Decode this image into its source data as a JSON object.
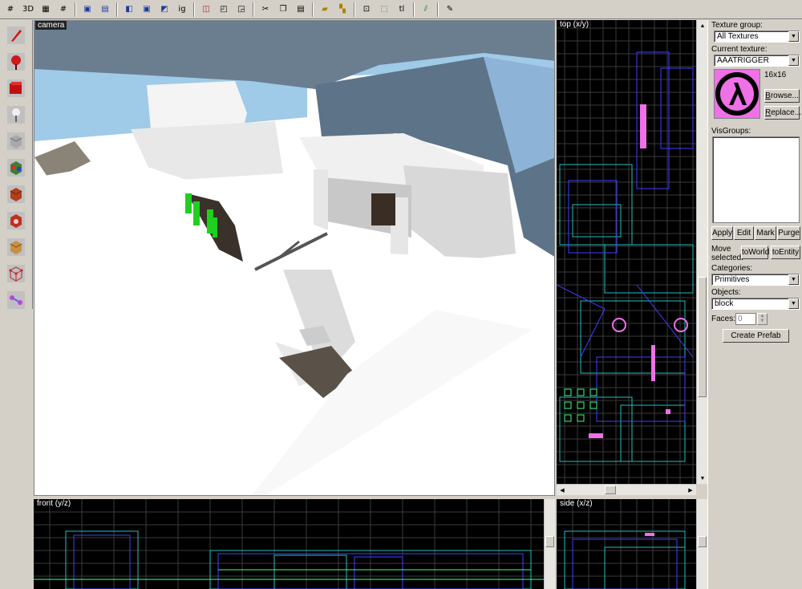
{
  "toolbar": {
    "buttons": [
      "grid-icon",
      "3d-grid-icon",
      "grid-small-icon",
      "grid-large-icon",
      "group-icon",
      "ungroup-icon",
      "hide-icon",
      "carve-icon",
      "ig",
      "hollow-icon",
      "cube-icon",
      "cube-outline-icon",
      "cut-icon",
      "copy-icon",
      "paste-icon",
      "texture-lock-icon",
      "texture-lock2-icon",
      "select-icon",
      "select-region-icon",
      "tl",
      "check-icon",
      "options-icon"
    ],
    "ig_label": "ig",
    "tl_label": "tl"
  },
  "tools": [
    "pointer-tool-icon",
    "magnify-tool-icon",
    "camera-tool-icon",
    "entity-tool-icon",
    "block-tool-icon",
    "texture-tool-icon",
    "apply-texture-icon",
    "decal-tool-icon",
    "clip-tool-icon",
    "vertex-tool-icon",
    "path-tool-icon"
  ],
  "viewports": {
    "camera": "camera",
    "top": "top (x/y)",
    "front": "front (y/z)",
    "side": "side (x/z)"
  },
  "panel": {
    "texture_group_label": "Texture group:",
    "texture_group_value": "All Textures",
    "current_texture_label": "Current texture:",
    "current_texture_value": "AAATRIGGER",
    "texture_size": "16x16",
    "browse": "Browse...",
    "replace": "Replace...",
    "visgroups_label": "VisGroups:",
    "apply": "Apply",
    "edit": "Edit",
    "mark": "Mark",
    "purge": "Purge",
    "move_selected_label": "Move selected:",
    "to_world": "toWorld",
    "to_entity": "toEntity",
    "categories_label": "Categories:",
    "categories_value": "Primitives",
    "objects_label": "Objects:",
    "objects_value": "block",
    "faces_label": "Faces:",
    "faces_value": "0",
    "create_prefab": "Create Prefab"
  },
  "colors": {
    "texture_pink": "#f070e8",
    "sky": "#9fcae8",
    "grid_bg": "#000000"
  }
}
